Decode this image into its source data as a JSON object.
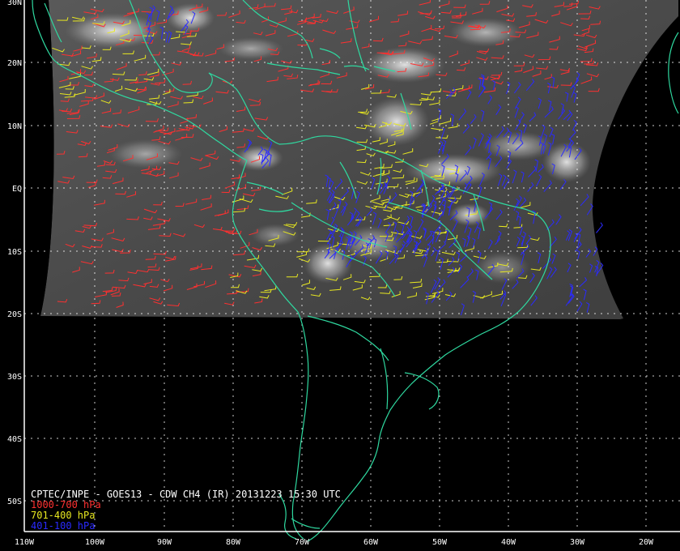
{
  "caption": {
    "title": "CPTEC/INPE - GOES13 - CDW CH4 (IR) 20131223 15:30 UTC",
    "legend": [
      {
        "label": "1000-700 hPa",
        "color": "#ff3030"
      },
      {
        "label": "701-400 hPa",
        "color": "#e8e820"
      },
      {
        "label": "401-100 hPa",
        "color": "#2a2aff"
      }
    ]
  },
  "axes": {
    "lat_labels": [
      "30N",
      "20N",
      "10N",
      "EQ",
      "10S",
      "20S",
      "30S",
      "40S",
      "50S"
    ],
    "lon_labels": [
      "110W",
      "100W",
      "90W",
      "80W",
      "70W",
      "60W",
      "50W",
      "40W",
      "30W",
      "20W"
    ]
  },
  "colors": {
    "coast": "#2fd9a0",
    "grid": "#ffffff",
    "low": "#ff3030",
    "mid": "#e8e820",
    "high": "#2a2aff"
  }
}
